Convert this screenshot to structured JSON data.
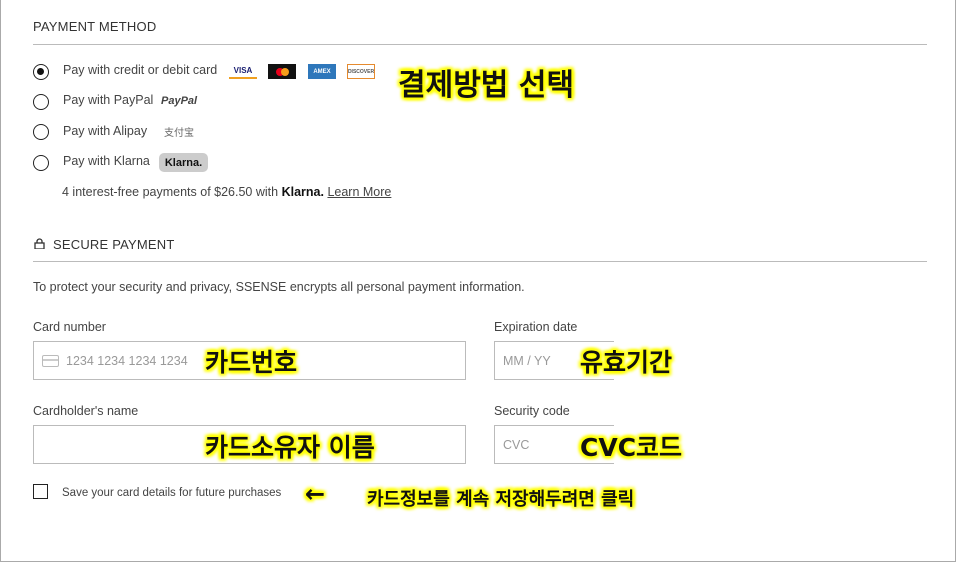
{
  "payment_method": {
    "title": "PAYMENT METHOD",
    "options": [
      {
        "label": "Pay with credit or debit card",
        "selected": true
      },
      {
        "label": "Pay with PayPal",
        "selected": false
      },
      {
        "label": "Pay with Alipay",
        "selected": false
      },
      {
        "label": "Pay with Klarna",
        "selected": false
      }
    ],
    "cards": [
      "VISA",
      "mastercard-icon",
      "AMEX",
      "DISCOVER"
    ],
    "paypal_logo": "PayPal",
    "alipay_logo": "支付宝",
    "klarna_badge": "Klarna.",
    "klarna_note": "4 interest-free payments of $26.50 with",
    "klarna_brand": "Klarna.",
    "learn_more": "Learn More"
  },
  "secure": {
    "title": "SECURE PAYMENT",
    "icon": "lock-icon",
    "note": "To protect your security and privacy, SSENSE encrypts all personal payment information.",
    "card_number_label": "Card number",
    "card_number_placeholder": "1234 1234 1234 1234",
    "expiration_label": "Expiration date",
    "expiration_placeholder": "MM / YY",
    "name_label": "Cardholder's name",
    "security_label": "Security code",
    "security_placeholder": "CVC",
    "save_label": "Save your card details for future purchases",
    "save_checked": false
  },
  "annotations": {
    "method": "결제방법 선택",
    "card_number": "카드번호",
    "expiration": "유효기간",
    "name": "카드소유자 이름",
    "cvc": "CVC코드",
    "save": "카드정보를 계속 저장해두려면 클릭",
    "arrow": "←"
  },
  "colors": {
    "highlight": "#ffff00",
    "amex": "#2e77bb",
    "discover": "#e58a2e"
  }
}
